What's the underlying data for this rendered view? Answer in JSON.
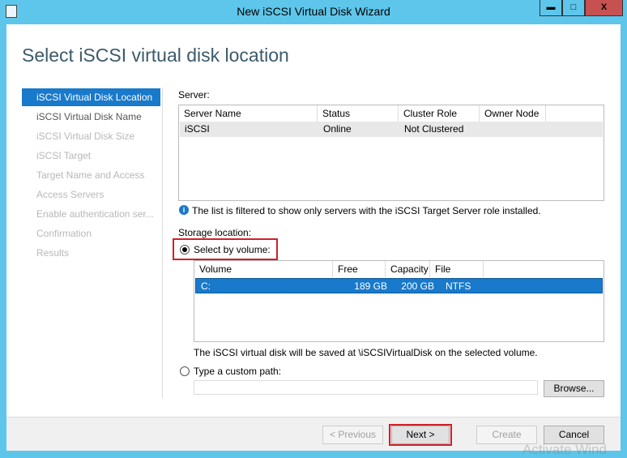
{
  "window": {
    "title": "New iSCSI Virtual Disk Wizard",
    "minimize": "▬",
    "maximize": "□",
    "close": "X"
  },
  "heading": "Select iSCSI virtual disk location",
  "nav": [
    {
      "label": "iSCSI Virtual Disk Location",
      "state": "active"
    },
    {
      "label": "iSCSI Virtual Disk Name",
      "state": "enabled"
    },
    {
      "label": "iSCSI Virtual Disk Size",
      "state": "disabled"
    },
    {
      "label": "iSCSI Target",
      "state": "disabled"
    },
    {
      "label": "Target Name and Access",
      "state": "disabled"
    },
    {
      "label": "Access Servers",
      "state": "disabled"
    },
    {
      "label": "Enable authentication ser...",
      "state": "disabled"
    },
    {
      "label": "Confirmation",
      "state": "disabled"
    },
    {
      "label": "Results",
      "state": "disabled"
    }
  ],
  "server": {
    "label": "Server:",
    "columns": [
      "Server Name",
      "Status",
      "Cluster Role",
      "Owner Node"
    ],
    "rows": [
      [
        "iSCSI",
        "Online",
        "Not Clustered",
        ""
      ]
    ]
  },
  "info": "The list is filtered to show only servers with the iSCSI Target Server role installed.",
  "storage": {
    "label": "Storage location:",
    "by_volume": "Select by volume:",
    "columns": [
      "Volume",
      "Free Space",
      "Capacity",
      "File System"
    ],
    "rows": [
      [
        "C:",
        "189 GB",
        "200 GB",
        "NTFS"
      ]
    ],
    "note": "The iSCSI virtual disk will be saved at \\iSCSIVirtualDisk on the selected volume.",
    "custom": "Type a custom path:",
    "custom_value": "",
    "browse": "Browse..."
  },
  "buttons": {
    "previous": "< Previous",
    "next": "Next >",
    "create": "Create",
    "cancel": "Cancel"
  },
  "watermark": "Activate Wind",
  "colors": {
    "titlebar": "#5ec6ea",
    "selection": "#1979ca",
    "highlight": "#d0202a",
    "close": "#c75050"
  }
}
